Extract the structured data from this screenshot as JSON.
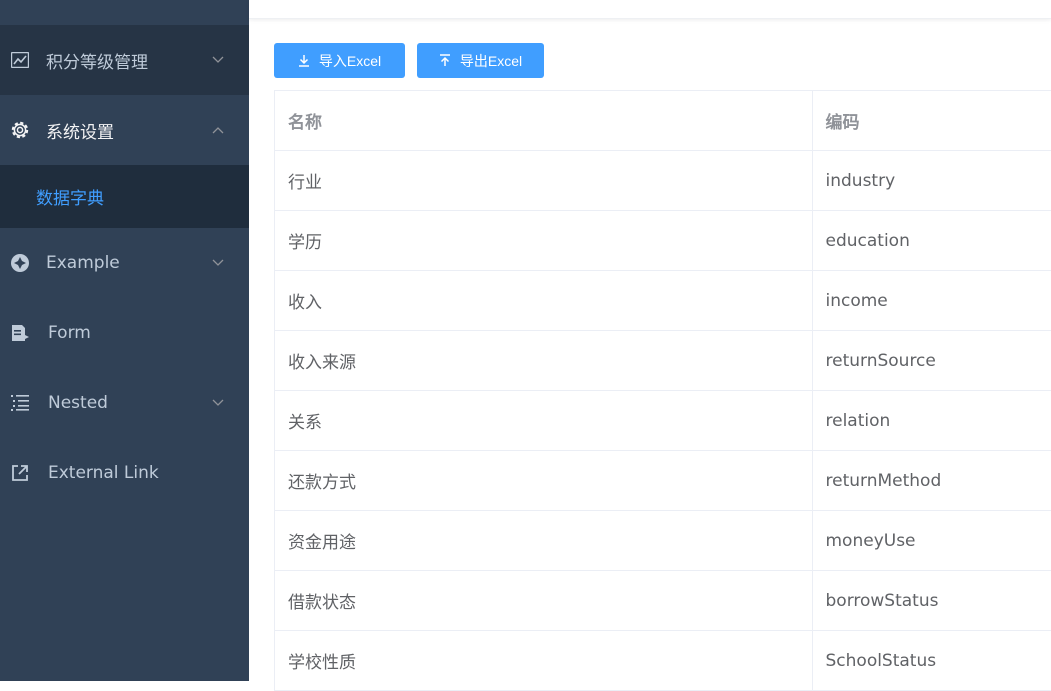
{
  "sidebar": {
    "items": [
      {
        "label": "积分等级管理",
        "icon": "chart-line-icon",
        "expandable": true
      },
      {
        "label": "系统设置",
        "icon": "gear-icon",
        "expandable": true,
        "expanded": true,
        "children": [
          {
            "label": "数据字典",
            "active": true
          }
        ]
      },
      {
        "label": "Example",
        "icon": "example-icon",
        "expandable": true
      },
      {
        "label": "Form",
        "icon": "form-icon",
        "expandable": false
      },
      {
        "label": "Nested",
        "icon": "nested-list-icon",
        "expandable": true
      },
      {
        "label": "External Link",
        "icon": "external-link-icon",
        "expandable": false
      }
    ],
    "active_color": "#409eff",
    "bg_color": "#304156"
  },
  "toolbar": {
    "import_label": "导入Excel",
    "export_label": "导出Excel",
    "button_color": "#409eff"
  },
  "table": {
    "columns": [
      "名称",
      "编码"
    ],
    "rows": [
      [
        "行业",
        "industry"
      ],
      [
        "学历",
        "education"
      ],
      [
        "收入",
        "income"
      ],
      [
        "收入来源",
        "returnSource"
      ],
      [
        "关系",
        "relation"
      ],
      [
        "还款方式",
        "returnMethod"
      ],
      [
        "资金用途",
        "moneyUse"
      ],
      [
        "借款状态",
        "borrowStatus"
      ],
      [
        "学校性质",
        "SchoolStatus"
      ]
    ]
  }
}
